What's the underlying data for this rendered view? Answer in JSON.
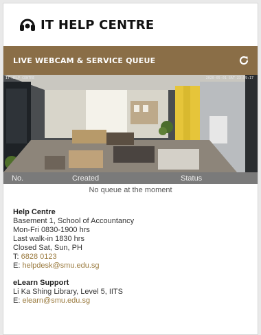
{
  "header": {
    "title": "IT HELP CENTRE"
  },
  "bar": {
    "title": "LIVE WEBCAM & SERVICE QUEUE"
  },
  "webcam": {
    "label": "IT HELP CENTRE",
    "timestamp": "2020-05-01 SAT 23:59:17"
  },
  "queue": {
    "columns": {
      "no": "No.",
      "created": "Created",
      "status": "Status"
    },
    "empty_message": "No queue at the moment"
  },
  "help_centre": {
    "title": "Help Centre",
    "address": "Basement 1, School of Accountancy",
    "hours": "Mon-Fri 0830-1900 hrs",
    "last_walkin": "Last walk-in 1830 hrs",
    "closed": "Closed Sat, Sun, PH",
    "phone_label": "T: ",
    "phone": "6828 0123",
    "email_label": "E: ",
    "email": "helpdesk@smu.edu.sg"
  },
  "elearn": {
    "title": "eLearn Support",
    "address": "Li Ka Shing Library, Level 5, IITS",
    "email_label": "E: ",
    "email": "elearn@smu.edu.sg"
  },
  "colors": {
    "accent": "#8a6e47",
    "link": "#9a7a3e",
    "queue_header": "#7a7a7a"
  },
  "icons": {
    "logo": "headset-icon",
    "refresh": "refresh-icon"
  }
}
